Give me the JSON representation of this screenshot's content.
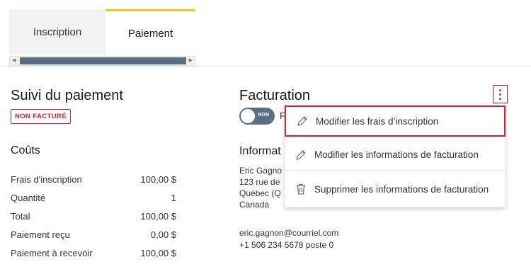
{
  "tabs": [
    {
      "label": "Inscription"
    },
    {
      "label": "Paiement"
    }
  ],
  "payment": {
    "title": "Suivi du paiement",
    "status_badge": "NON FACTURÉ",
    "costs_title": "Coûts",
    "rows": [
      {
        "label": "Frais d'inscription",
        "value": "100,00 $"
      },
      {
        "label": "Quantité",
        "value": "1"
      },
      {
        "label": "Total",
        "value": "100,00 $"
      },
      {
        "label": "Paiement reçu",
        "value": "0,00 $"
      },
      {
        "label": "Paiement à recevoir",
        "value": "100,00 $"
      }
    ]
  },
  "billing": {
    "title": "Facturation",
    "toggle_text": "NON",
    "toggle_label": "F",
    "info_title": "Informat",
    "address_lines": [
      "Eric Gagno",
      "123 rue de",
      "Québec (Q",
      "Canada"
    ],
    "email": "eric.gagnon@courriel.com",
    "phone": "+1 506 234 5678 poste 0"
  },
  "menu": {
    "items": [
      {
        "label": "Modifier les frais d’inscription",
        "icon": "pencil-icon"
      },
      {
        "label": "Modifier les informations de facturation",
        "icon": "pencil-icon"
      },
      {
        "label": "Supprimer les informations de facturation",
        "icon": "trash-icon"
      }
    ]
  },
  "colors": {
    "accent_tab": "#f5c518",
    "danger": "#d0232b",
    "slate": "#5a6e86"
  }
}
